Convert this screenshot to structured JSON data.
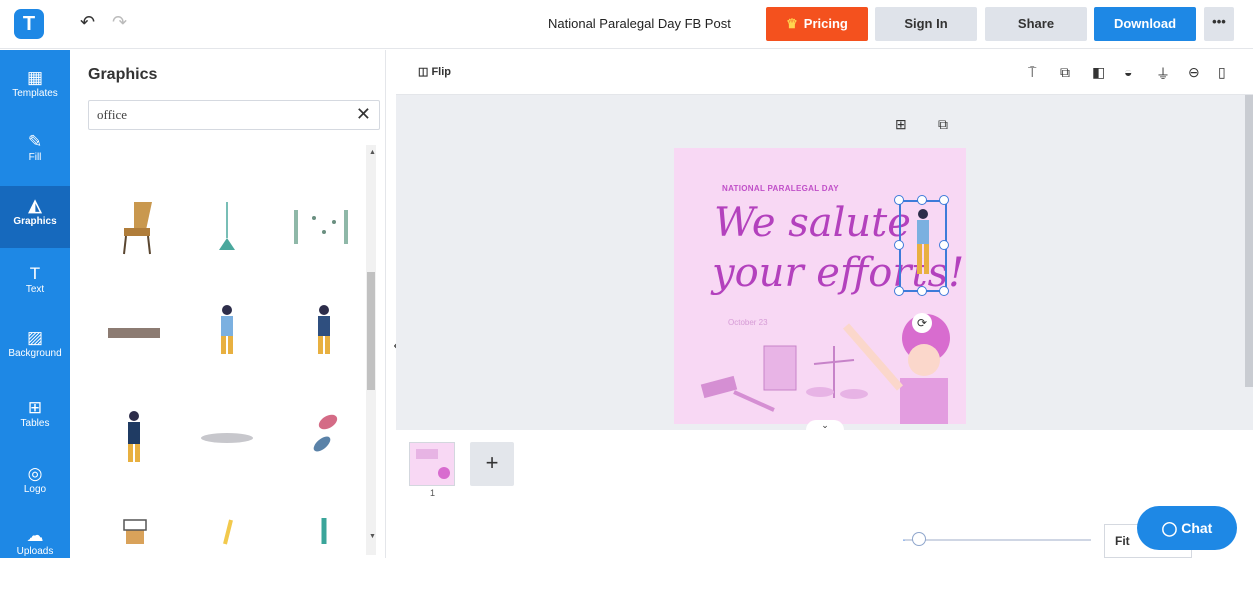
{
  "header": {
    "logo_letter": "T",
    "undo_icon": "undo-icon",
    "redo_icon": "redo-icon",
    "doc_title": "National Paralegal Day FB Post",
    "pricing_label": "Pricing",
    "signin_label": "Sign In",
    "share_label": "Share",
    "download_label": "Download",
    "more_label": "•••"
  },
  "sidebar": {
    "items": [
      {
        "label": "Templates",
        "icon": "templates-icon",
        "glyph": "▦"
      },
      {
        "label": "Fill",
        "icon": "pencil-icon",
        "glyph": "✎"
      },
      {
        "label": "Graphics",
        "icon": "graphics-icon",
        "glyph": "◭"
      },
      {
        "label": "Text",
        "icon": "text-icon",
        "glyph": "T"
      },
      {
        "label": "Background",
        "icon": "background-icon",
        "glyph": "▨"
      },
      {
        "label": "Tables",
        "icon": "tables-icon",
        "glyph": "⊞"
      },
      {
        "label": "Logo",
        "icon": "logo-icon",
        "glyph": "◎"
      },
      {
        "label": "Uploads",
        "icon": "upload-icon",
        "glyph": "☁"
      }
    ],
    "active": "Graphics"
  },
  "panel": {
    "title": "Graphics",
    "search_value": "office",
    "clear_icon": "✕",
    "graphics": [
      "desk-chair",
      "floor-lamp",
      "wall-shelf",
      "wooden-plank",
      "office-worker-walking",
      "office-worker-holding-file",
      "office-worker-standing",
      "grey-shadow",
      "pink-blue-leaves",
      "binder-clip",
      "pencil",
      "pen"
    ]
  },
  "toolbar": {
    "flip_label": "Flip",
    "icons": [
      "paint-roller-icon",
      "duplicate-icon",
      "layers-icon",
      "opacity-icon",
      "align-icon",
      "link-icon",
      "delete-icon"
    ]
  },
  "artboard": {
    "heading": "NATIONAL PARALEGAL DAY",
    "script_line1": "We salute",
    "script_line2": "your efforts!",
    "date_text": "October 23"
  },
  "bottom": {
    "page_number": "1",
    "add_page": "+",
    "fit_label": "Fit",
    "chat_label": "Chat",
    "zoom_percent": 4
  },
  "colors": {
    "brand_blue": "#1e88e5",
    "pricing_orange": "#f4511e",
    "artboard_pink": "#f8d8f4",
    "script_purple": "#b341bd"
  }
}
